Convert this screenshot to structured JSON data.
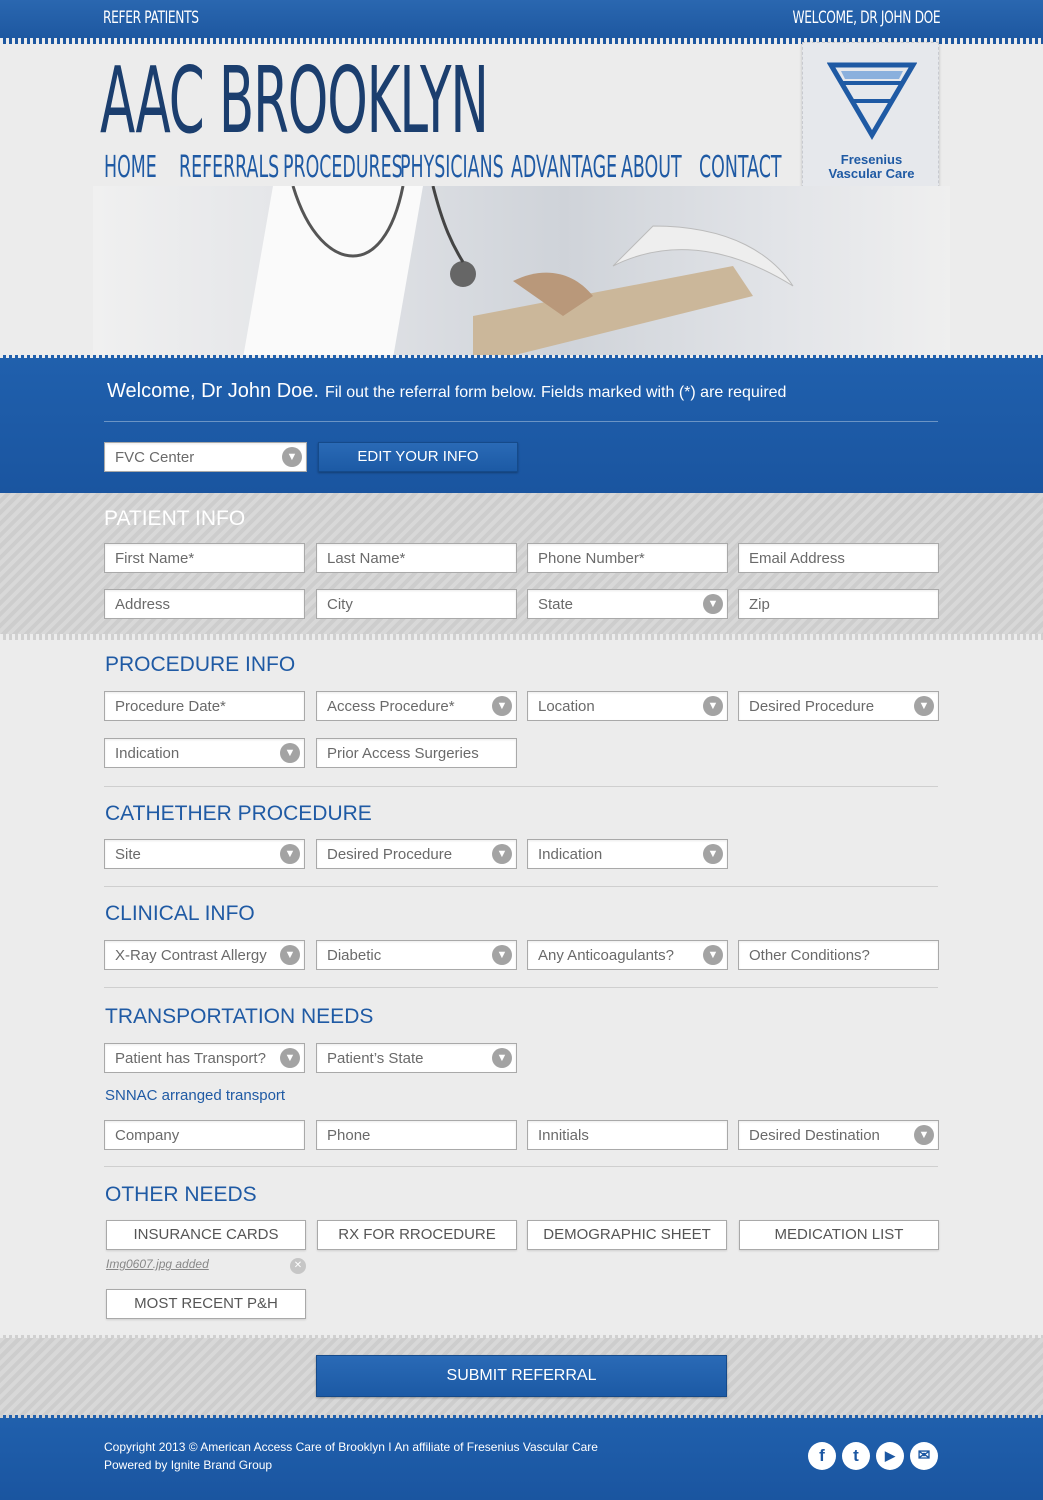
{
  "topbar": {
    "left": "REFER PATIENTS",
    "right": "WELCOME, DR JOHN DOE"
  },
  "brand": "AAC BROOKLYN",
  "nav": [
    "HOME",
    "REFERRALS",
    "PROCEDURES",
    "PHYSICIANS",
    "ADVANTAGE",
    "ABOUT",
    "CONTACT"
  ],
  "logo": {
    "line1": "Fresenius",
    "line2": "Vascular Care"
  },
  "welcome": {
    "greeting": "Welcome, Dr John Doe.",
    "instructions": "Fil out the referral form below. Fields marked with (*) are required"
  },
  "center_select": "FVC Center",
  "edit_button": "EDIT YOUR INFO",
  "patient": {
    "title": "PATIENT INFO",
    "first_name": "First Name*",
    "last_name": "Last Name*",
    "phone": "Phone Number*",
    "email": "Email Address",
    "address": "Address",
    "city": "City",
    "state": "State",
    "zip": "Zip"
  },
  "procedure": {
    "title": "PROCEDURE INFO",
    "date": "Procedure Date*",
    "access": "Access Procedure*",
    "location": "Location",
    "desired": "Desired Procedure",
    "indication": "Indication",
    "prior": "Prior Access Surgeries"
  },
  "catheter": {
    "title": "CATHETHER PROCEDURE",
    "site": "Site",
    "desired": "Desired Procedure",
    "indication": "Indication"
  },
  "clinical": {
    "title": "CLINICAL INFO",
    "allergy": "X-Ray Contrast Allergy",
    "diabetic": "Diabetic",
    "anticoag": "Any Anticoagulants?",
    "other": "Other Conditions?"
  },
  "transport": {
    "title": "TRANSPORTATION NEEDS",
    "has_transport": "Patient has Transport?",
    "patient_state": "Patient’s State",
    "snnac": "SNNAC arranged transport",
    "company": "Company",
    "phone": "Phone",
    "initials": "Innitials",
    "destination": "Desired Destination"
  },
  "other": {
    "title": "OTHER NEEDS",
    "buttons": [
      "INSURANCE CARDS",
      "RX FOR RROCEDURE",
      "DEMOGRAPHIC SHEET",
      "MEDICATION LIST"
    ],
    "attached": "Img0607.jpg added",
    "recent": "MOST RECENT P&H"
  },
  "submit": "SUBMIT REFERRAL",
  "footer": {
    "copyright": "Copyright 2013 © American Access Care of Brooklyn  I  An affiliate of Fresenius Vascular Care",
    "powered": "Powered by Ignite Brand Group"
  },
  "social": [
    {
      "name": "facebook-icon",
      "glyph": "f"
    },
    {
      "name": "twitter-icon",
      "glyph": "t"
    },
    {
      "name": "youtube-icon",
      "glyph": "▶"
    },
    {
      "name": "email-icon",
      "glyph": "✉"
    }
  ],
  "colors": {
    "brand_blue": "#1f5aa4",
    "dark_navy": "#1b3e6e"
  }
}
